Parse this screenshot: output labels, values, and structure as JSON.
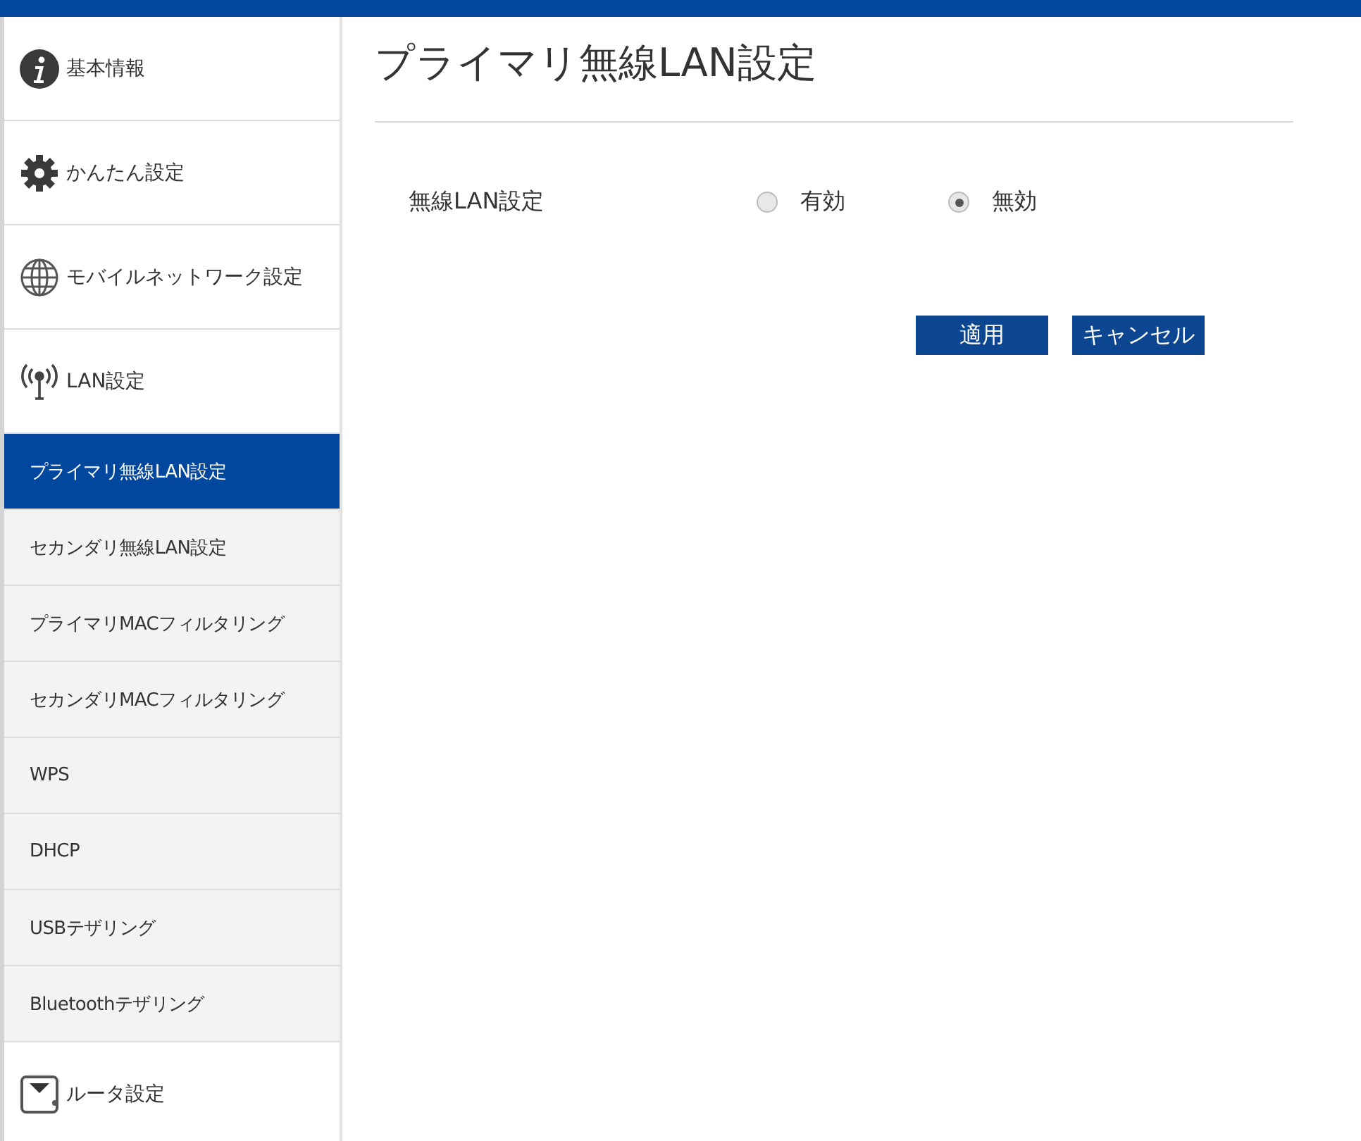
{
  "sidebar": {
    "items": [
      {
        "kind": "section",
        "label": "基本情報",
        "selected": false
      },
      {
        "kind": "section",
        "label": "かんたん設定",
        "selected": false
      },
      {
        "kind": "section",
        "label": "モバイルネットワーク設定",
        "selected": false
      },
      {
        "kind": "section",
        "label": "LAN設定",
        "selected": false
      },
      {
        "kind": "sub",
        "label": "プライマリ無線LAN設定",
        "selected": true
      },
      {
        "kind": "sub",
        "label": "セカンダリ無線LAN設定",
        "selected": false
      },
      {
        "kind": "sub",
        "label": "プライマリMACフィルタリング",
        "selected": false
      },
      {
        "kind": "sub",
        "label": "セカンダリMACフィルタリング",
        "selected": false
      },
      {
        "kind": "sub",
        "label": "WPS",
        "selected": false
      },
      {
        "kind": "sub",
        "label": "DHCP",
        "selected": false
      },
      {
        "kind": "sub",
        "label": "USBテザリング",
        "selected": false
      },
      {
        "kind": "sub",
        "label": "Bluetoothテザリング",
        "selected": false
      },
      {
        "kind": "section",
        "label": "ルータ設定",
        "selected": false
      }
    ]
  },
  "page": {
    "title": "プライマリ無線LAN設定",
    "setting": {
      "label": "無線LAN設定",
      "options": [
        {
          "label": "有効",
          "selected": false
        },
        {
          "label": "無効",
          "selected": true
        }
      ]
    },
    "buttons": [
      "適用",
      "キャンセル"
    ]
  }
}
